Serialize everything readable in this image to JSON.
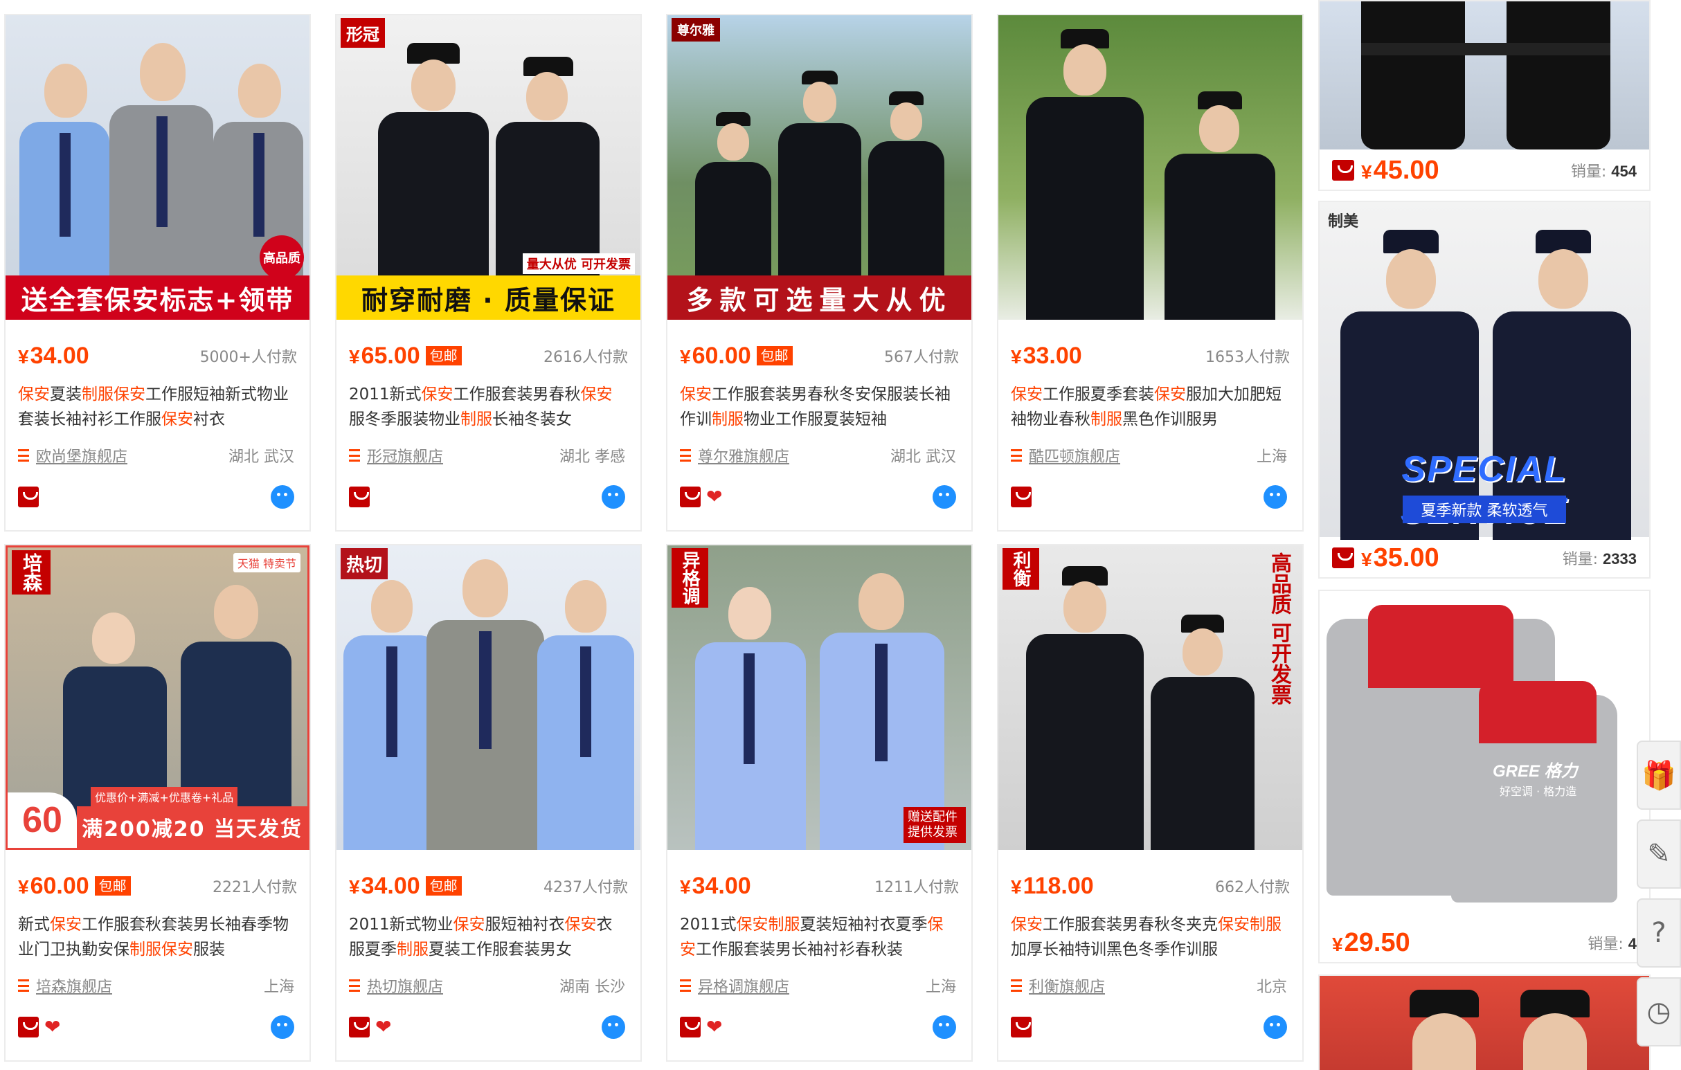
{
  "products": [
    {
      "banner": "送全套保安标志+领带",
      "price": "34.00",
      "baoyou": "",
      "sold": "5000+人付款",
      "title": [
        "保安",
        "夏装",
        "制服保安",
        "工作服短袖新式物业套装长袖衬衫工作服",
        "保安",
        "衬衣"
      ],
      "shop": "欧尚堡旗舰店",
      "location": "湖北 武汉",
      "badges": [
        "tmall-badge"
      ],
      "tag": "高品质"
    },
    {
      "banner": "耐穿耐磨 · 质量保证",
      "price": "65.00",
      "baoyou": "包邮",
      "sold": "2616人付款",
      "title": [
        "2011新式",
        "保安",
        "工作服套装男春秋",
        "保安",
        "服冬季服装物业",
        "制服",
        "长袖冬装女"
      ],
      "shop": "形冠旗舰店",
      "location": "湖北 孝感",
      "badges": [
        "tmall-badge"
      ],
      "tag": "形冠",
      "sub_tag": "量大从优 可开发票"
    },
    {
      "banner": "多款可选量大从优",
      "price": "60.00",
      "baoyou": "包邮",
      "sold": "567人付款",
      "title": [
        "保安",
        "工作服套装男春秋冬安保服装长袖作训",
        "制服",
        "物业工作服夏装短袖"
      ],
      "shop": "尊尔雅旗舰店",
      "location": "湖北 武汉",
      "badges": [
        "tmall-badge",
        "heart-badge"
      ],
      "tag": "尊尔雅"
    },
    {
      "banner": "",
      "price": "33.00",
      "baoyou": "",
      "sold": "1653人付款",
      "title": [
        "保安",
        "工作服夏季套装",
        "保安",
        "服加大加肥短袖物业春秋",
        "制服",
        "黑色作训服男"
      ],
      "shop": "酷匹顿旗舰店",
      "location": "上海",
      "badges": [
        "tmall-badge"
      ],
      "tag": ""
    },
    {
      "banner": "满200减20 当天发货",
      "price": "60.00",
      "baoyou": "包邮",
      "sold": "2221人付款",
      "title": [
        "新式",
        "保安",
        "工作服套秋套装男长袖春季物业门卫执勤安保",
        "制服保安",
        "服装"
      ],
      "shop": "培森旗舰店",
      "location": "上海",
      "badges": [
        "tmall-badge",
        "heart-badge"
      ],
      "tag": "培森",
      "badge_60": "60",
      "promo_small": "优惠价+满减+优惠卷+礼品",
      "tmall_festival": "天猫 特卖节"
    },
    {
      "banner": "",
      "price": "34.00",
      "baoyou": "包邮",
      "sold": "4237人付款",
      "title": [
        "2011新式物业",
        "保安",
        "服短袖衬衣",
        "保安",
        "衣服夏季",
        "制服",
        "夏装工作服套装男女"
      ],
      "shop": "热切旗舰店",
      "location": "湖南 长沙",
      "badges": [
        "tmall-badge",
        "heart-badge"
      ],
      "tag": "热切"
    },
    {
      "banner": "",
      "price": "34.00",
      "baoyou": "",
      "sold": "1211人付款",
      "title": [
        "2011式",
        "保安制服",
        "夏装短袖衬衣夏季",
        "保安",
        "工作服套装男长袖衬衫春秋装"
      ],
      "shop": "异格调旗舰店",
      "location": "上海",
      "badges": [
        "tmall-badge",
        "heart-badge"
      ],
      "tag": "异格调",
      "corner_note": "赠送配件 提供发票"
    },
    {
      "banner": "",
      "price": "118.00",
      "baoyou": "",
      "sold": "662人付款",
      "title": [
        "保安",
        "工作服套装男春秋冬夹克",
        "保安制服",
        "加厚长袖特训黑色冬季作训服"
      ],
      "shop": "利衡旗舰店",
      "location": "北京",
      "badges": [
        "tmall-badge"
      ],
      "tag": "利衡",
      "side_text": "高品质 可开发票"
    }
  ],
  "right_column": [
    {
      "price": "45.00",
      "sales_label": "销量:",
      "sales": "454"
    },
    {
      "price": "35.00",
      "sales_label": "销量:",
      "sales": "2333",
      "brand": "制美",
      "overlay": "SPECIAL SERVICE",
      "sub_overlay": "夏季新款 柔软透气"
    },
    {
      "price": "29.50",
      "sales_label": "销量:",
      "sales": "4",
      "logo": "GREE 格力",
      "logo_sub": "好空调 · 格力造"
    }
  ],
  "side_tools": [
    "gift-icon",
    "edit-icon",
    "help-icon",
    "clock-icon"
  ],
  "colors": {
    "accent": "#ff4200",
    "tmall_red": "#c40000",
    "wangwang_blue": "#1e90ff"
  }
}
